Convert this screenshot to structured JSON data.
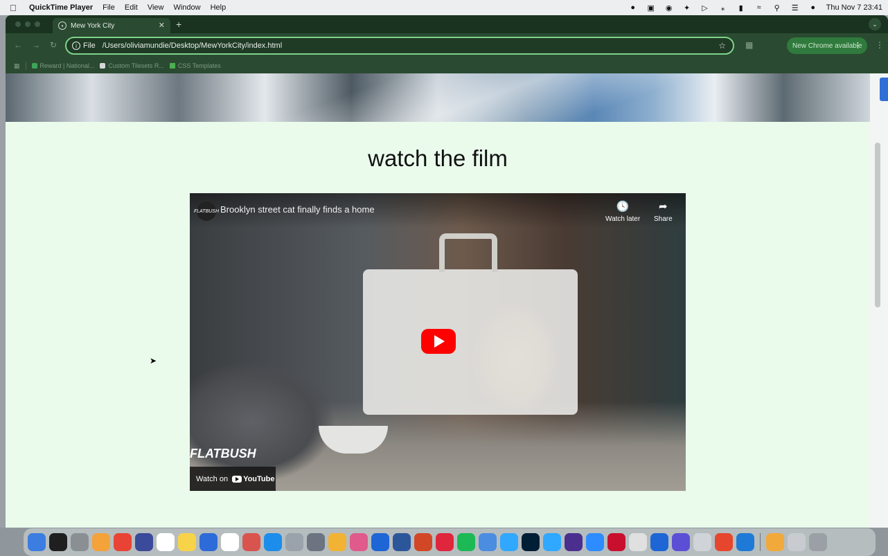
{
  "menubar": {
    "app_name": "QuickTime Player",
    "menus": [
      "File",
      "Edit",
      "View",
      "Window",
      "Help"
    ],
    "clock": "Thu Nov 7  23:41"
  },
  "browser": {
    "tab_title": "Mew York City",
    "url_scheme": "File",
    "url": "/Users/oliviamundie/Desktop/MewYorkCity/index.html",
    "update_button": "New Chrome available",
    "bookmarks": [
      "Reward | National...",
      "Custom Tilesets R...",
      "CSS Templates"
    ]
  },
  "page": {
    "heading": "watch the film"
  },
  "video": {
    "title": "Brooklyn street cat finally finds a home",
    "channel_logo": "FLATBUSH",
    "watch_later": "Watch later",
    "share": "Share",
    "watch_on": "Watch on",
    "youtube": "YouTube",
    "overlay_text": "FLATBUSH"
  },
  "dock": {
    "app_colors": [
      "#3b7de0",
      "#1f1f1f",
      "#8a8f94",
      "#f3a33a",
      "#e94335",
      "#3b4a9a",
      "#ffffff",
      "#f7d34a",
      "#2d6bd8",
      "#ffffff",
      "#d9534f",
      "#1c8dea",
      "#9aa3ab",
      "#6b7480",
      "#f2b233",
      "#e05a8c",
      "#1e66d6",
      "#2b579a",
      "#d24726",
      "#e0263c",
      "#1db954",
      "#4b8de0",
      "#31a8ff",
      "#001e36",
      "#31a8ff",
      "#4a2f8f",
      "#2d8cff",
      "#c8102e",
      "#e0e0e0",
      "#1e66d6",
      "#5b4fd6",
      "#d0d4d8",
      "#e6462d",
      "#1e7ad6",
      "#f2a93b",
      "#c8ccd0",
      "#9aa0a6"
    ]
  }
}
